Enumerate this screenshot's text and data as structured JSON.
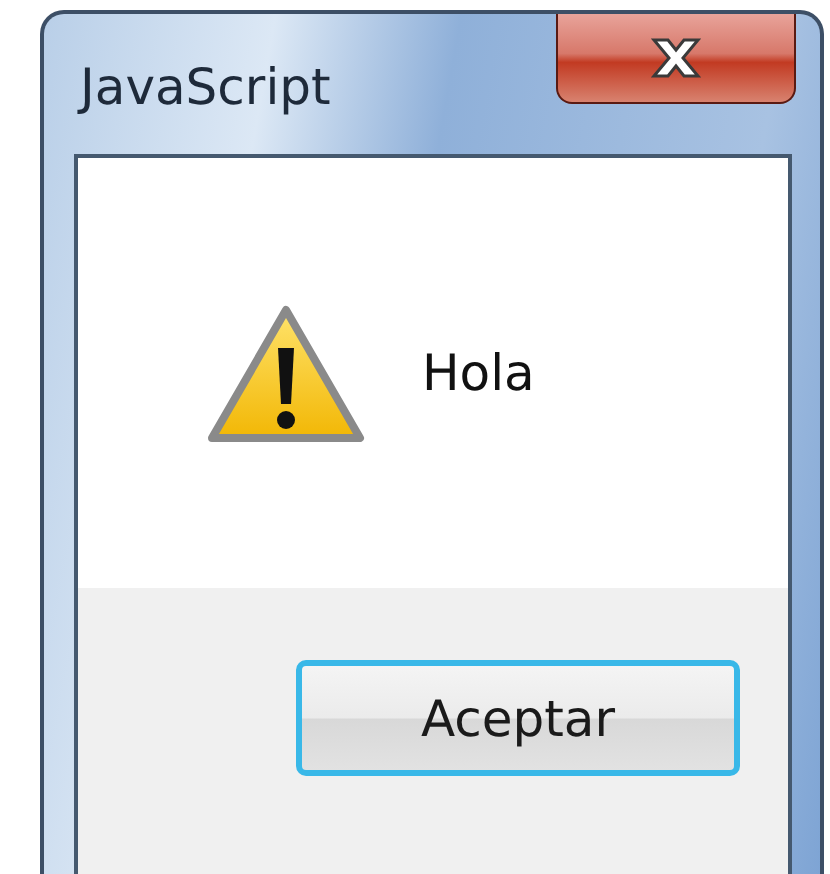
{
  "window": {
    "title": "JavaScript"
  },
  "message": "Hola",
  "buttons": [
    {
      "label": "Aceptar",
      "focused": true
    }
  ]
}
